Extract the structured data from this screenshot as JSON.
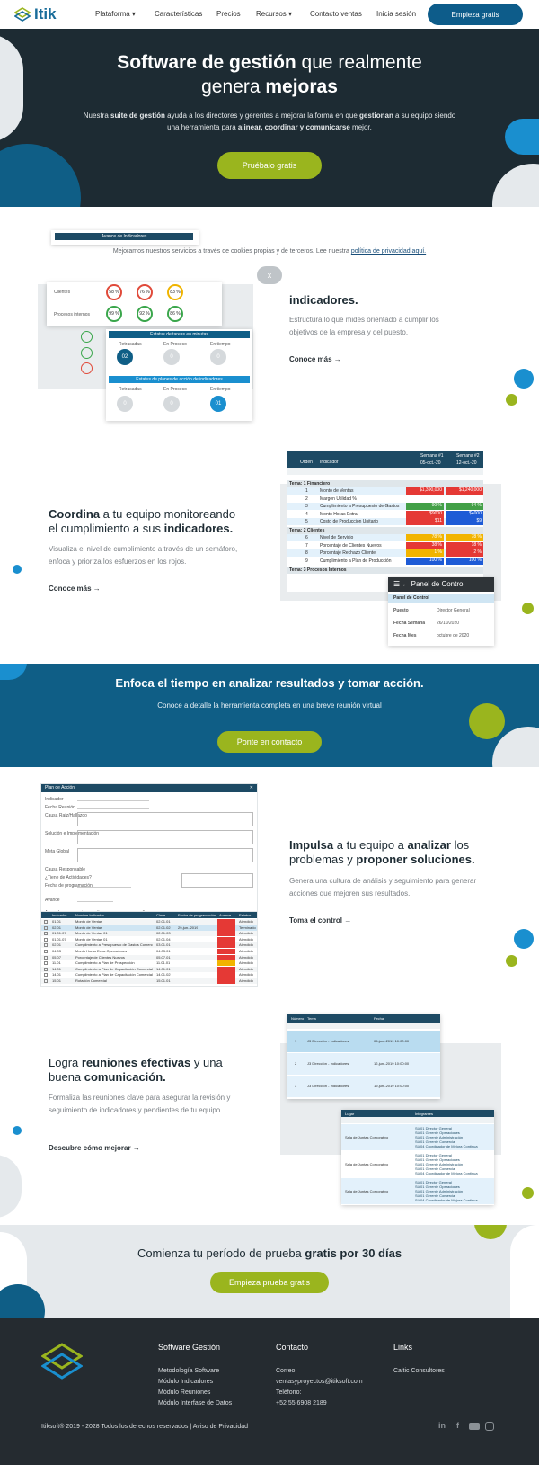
{
  "header": {
    "logo_text": "Itik",
    "nav": [
      "Plataforma",
      "Características",
      "Precios",
      "Recursos",
      "Contacto ventas",
      "Inicia sesión"
    ],
    "cta": "Empieza gratis"
  },
  "hero": {
    "title_bold1": "Software de gestión",
    "title_rest1": " que realmente",
    "title_rest2": "genera ",
    "title_bold2": "mejoras",
    "desc_a": "Nuestra ",
    "desc_b": "suite de gestión",
    "desc_c": " ayuda a los directores y gerentes a mejorar la forma en que ",
    "desc_d": "gestionan",
    "desc_e": " a su equipo siendo una herramienta para ",
    "desc_f": "alinear, coordinar y comunicarse",
    "desc_g": " mejor.",
    "button": "Pruébalo gratis"
  },
  "cookie": {
    "text": "Mejoramos nuestros servicios a través de cookies propias y de terceros. Lee nuestra ",
    "link": "política de privacidad aquí.",
    "close": "x"
  },
  "feature1": {
    "title_bold": "indicadores.",
    "desc": "Estructura lo que mides orientado a cumplir los objetivos de la empresa y del puesto.",
    "link": "Conoce más →",
    "shot": {
      "header": "Avance de Indicadores",
      "rows": [
        "Clientes",
        "Procesos internos"
      ],
      "gauges": [
        "58 %",
        "76 %",
        "83 %",
        "99 %",
        "92 %",
        "86 %"
      ],
      "panel1_title": "Estatus de tareas en minutas",
      "panel2_title": "Estatus de planes de acción de indicadores",
      "cols": [
        "Retrasadas",
        "En Proceso",
        "En tiempo"
      ],
      "p1_values": [
        "02",
        "0",
        "0"
      ],
      "p2_values": [
        "0",
        "0",
        "01"
      ]
    }
  },
  "feature2": {
    "title_bold1": "Coordina",
    "title_rest1": " a tu equipo monitoreando",
    "title_rest2": "el cumplimiento a sus ",
    "title_bold2": "indicadores.",
    "desc": "Visualiza el nivel de cumplimiento a través de un semáforo, enfoca y prioriza los esfuerzos en los rojos.",
    "link": "Conoce más →",
    "shot": {
      "col_order": "Orden",
      "col_indicator": "Indicador",
      "week1": "Semana #1",
      "week1_date": "05-oct.-20",
      "week2": "Semana #2",
      "week2_date": "12-oct.-20",
      "theme1": "Tema: 1 Financiero",
      "rows1": [
        {
          "n": "1",
          "name": "Monto de Ventas",
          "a": "$1,390,000",
          "b": "$1,240,000"
        },
        {
          "n": "2",
          "name": "Margen Utilidad %",
          "a": "",
          "b": ""
        },
        {
          "n": "3",
          "name": "Cumplimiento a Presupuesto de Gastos",
          "a": "90 %",
          "b": "94 %"
        },
        {
          "n": "4",
          "name": "Monto Horas Extra",
          "a": "$9000",
          "b": "$4000"
        },
        {
          "n": "5",
          "name": "Costo de Producción Unitario",
          "a": "$11",
          "b": "$9"
        }
      ],
      "theme2": "Tema: 2 Clientes",
      "rows2": [
        {
          "n": "6",
          "name": "Nivel de Servicio",
          "a": "78 %",
          "b": "78 %"
        },
        {
          "n": "7",
          "name": "Porcentaje de Clientes Nuevos",
          "a": "38 %",
          "b": "18 %"
        },
        {
          "n": "8",
          "name": "Porcentaje Rechazo Cliente",
          "a": "1 %",
          "b": "2 %"
        },
        {
          "n": "9",
          "name": "Cumplimiento a Plan de Producción",
          "a": "100 %",
          "b": "100 %"
        }
      ],
      "theme3": "Tema: 3 Procesos Internos",
      "panel_title": "Panel de Control",
      "panel_sub": "Panel de Control",
      "panel_fields": [
        {
          "label": "Puesto",
          "value": "Director General"
        },
        {
          "label": "Fecha Semana",
          "value": "26/10/2020"
        },
        {
          "label": "Fecha Mes",
          "value": "octubre de 2020"
        }
      ]
    }
  },
  "band": {
    "title": "Enfoca el tiempo en analizar resultados y tomar acción.",
    "desc": "Conoce a detalle la herramienta completa en una breve reunión virtual",
    "button": "Ponte en contacto"
  },
  "feature3": {
    "title_a": "Impulsa",
    "title_b": " a tu equipo  a ",
    "title_c": "analizar",
    "title_d": " los",
    "title_e": "problemas y ",
    "title_f": "proponer soluciones.",
    "desc": "Genera una cultura de análisis y seguimiento para generar acciones que mejoren sus resultados.",
    "link": "Toma el control →",
    "shot": {
      "title": "Plan de Acción",
      "labels": [
        "Indicador",
        "Fecha Reunión",
        "Causa Raíz/Hallazgo",
        "Solución e Implementación",
        "Meta Global",
        "Causa Responsable",
        "¿Tiene de Actividades?",
        "Fecha de programación",
        "Avance"
      ],
      "table_caption": "Acuerdos por reuniones: click para agregar por año",
      "cols": [
        "Indicador",
        "Nombre Indicador",
        "Clave",
        "Fecha de programación",
        "Avance",
        "Estatus"
      ],
      "rows": [
        [
          "01.01",
          "Monto de Ventas",
          "02.01.01",
          "",
          "",
          "Atendido"
        ],
        [
          "02.01",
          "Monto de Ventas",
          "02.01.02",
          "29-jun.-2019",
          "",
          "Terminado"
        ],
        [
          "01.01.07",
          "Monto de Ventas 01",
          "02.01.03",
          "",
          "",
          "Atendido"
        ],
        [
          "01.01.07",
          "Monto de Ventas 01",
          "02.01.04",
          "",
          "",
          "Atendido"
        ],
        [
          "02.01",
          "Cumplimiento a Presupuesto de Gastos Comercial",
          "03.01.01",
          "",
          "",
          "Atendido"
        ],
        [
          "04.03",
          "Monto Horas Extra Operaciones",
          "04.03.01",
          "",
          "",
          "Atendido"
        ],
        [
          "05.07",
          "Porcentaje de Clientes Nuevos",
          "05.07.01",
          "",
          "",
          "Atendido"
        ],
        [
          "11.01",
          "Cumplimiento a Plan de Prospección",
          "11.01.01",
          "",
          "",
          "Atendido"
        ],
        [
          "14.01",
          "Cumplimiento a Plan de Capacitación Comercial",
          "14.01.01",
          "",
          "",
          "Atendido"
        ],
        [
          "14.01",
          "Cumplimiento a Plan de Capacitación Comercial",
          "14.01.02",
          "",
          "",
          "Atendido"
        ],
        [
          "15.01",
          "Rotación Comercial",
          "15.01.01",
          "",
          "",
          "Atendido"
        ]
      ]
    }
  },
  "feature4": {
    "title_a": "Logra ",
    "title_b": "reuniones efectivas",
    "title_c": " y una",
    "title_d": "buena ",
    "title_e": "comunicación.",
    "desc": "Formaliza las reuniones clave para asegurar la revisión y seguimiento de indicadores y pendientes de tu equipo.",
    "link": "Descubre cómo mejorar →",
    "shot": {
      "cols": [
        "Número",
        "Tema",
        "Fecha"
      ],
      "rows": [
        {
          "n": "1",
          "tema": "J3 Dirección - Indicadores",
          "fecha": "05-jun.-2019 10:00:00"
        },
        {
          "n": "2",
          "tema": "J3 Dirección - Indicadores",
          "fecha": "12-jun.-2019 10:00:00"
        },
        {
          "n": "3",
          "tema": "J3 Dirección - Indicadores",
          "fecha": "19-jun.-2019 10:00:00"
        }
      ],
      "cols2": [
        "Lugar",
        "Integrantes"
      ],
      "rooms": [
        "Sala de Juntas Corporativo",
        "Sala de Juntas Corporativo",
        "Sala de Juntas Corporativo"
      ],
      "members": [
        "Sü.01 Director General",
        "Sü.01 Gerente Operaciones",
        "Sü.01 Gerente Administración",
        "Sü.01 Gerente Comercial",
        "Sü.04 Coordinador de Mejora Continua"
      ]
    }
  },
  "trial": {
    "title_a": "Comienza tu período de prueba ",
    "title_b": "gratis por 30 días",
    "button": "Empieza prueba gratis"
  },
  "footer": {
    "col1_title": "Software Gestión",
    "col1_items": [
      "Metodología Software",
      "Módulo Indicadores",
      "Módulo Reuniones",
      "Módulo Interfase de Datos"
    ],
    "col2_title": "Contacto",
    "col2_items": [
      "Correo:",
      "ventasyproyectos@itiksoft.com",
      "Teléfono:",
      "+52 55 6908 2189"
    ],
    "col3_title": "Links",
    "col3_items": [
      "Caltic Consultores"
    ],
    "copyright": "Itiksoft® 2019 - 2028 Todos los derechos reservados | Aviso de Privacidad",
    "social": [
      "linkedin-icon",
      "facebook-icon",
      "youtube-icon",
      "instagram-icon"
    ]
  },
  "colors": {
    "navy": "#1d2b33",
    "blue": "#0f5e86",
    "green": "#9ab51e",
    "light_blue": "#1a8fcf"
  }
}
